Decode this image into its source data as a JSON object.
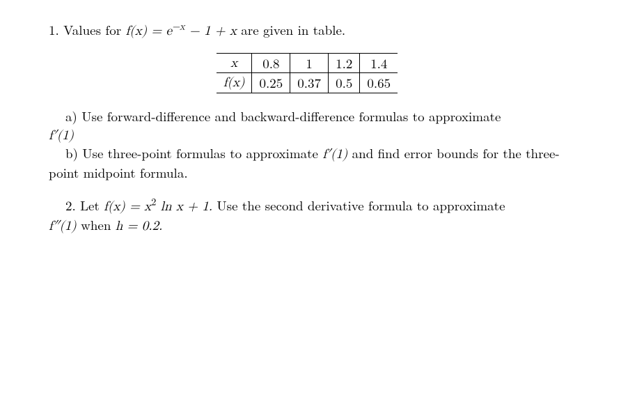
{
  "p1": {
    "number": "1.",
    "intro_pre": "Values for ",
    "func_lhs": "f(x) = e",
    "exp": "−x",
    "func_rhs": " − 1 + x",
    "intro_post": " are given in table.",
    "table": {
      "row1_label": "x",
      "row1": [
        "0.8",
        "1",
        "1.2",
        "1.4"
      ],
      "row2_label": "f(x)",
      "row2": [
        "0.25",
        "0.37",
        "0.5",
        "0.65"
      ]
    },
    "a_label": "a)",
    "a_text": " Use forward-difference and backward-difference formulas to approximate",
    "a_fprime": "f′(1)",
    "b_label": "b)",
    "b_text_pre": " Use three-point formulas to approximate ",
    "b_fprime": "f′(1)",
    "b_text_post": " and find error bounds for the three-point midpoint formula."
  },
  "p2": {
    "number": "2.",
    "let": " Let ",
    "func_lhs": "f(x) = x",
    "exp": "2",
    "func_mid": " ln x + 1.",
    "text_mid": " Use the second derivative formula to approximate ",
    "fpp": "f″(1)",
    "when": " when ",
    "h_eq": "h = 0.2."
  }
}
